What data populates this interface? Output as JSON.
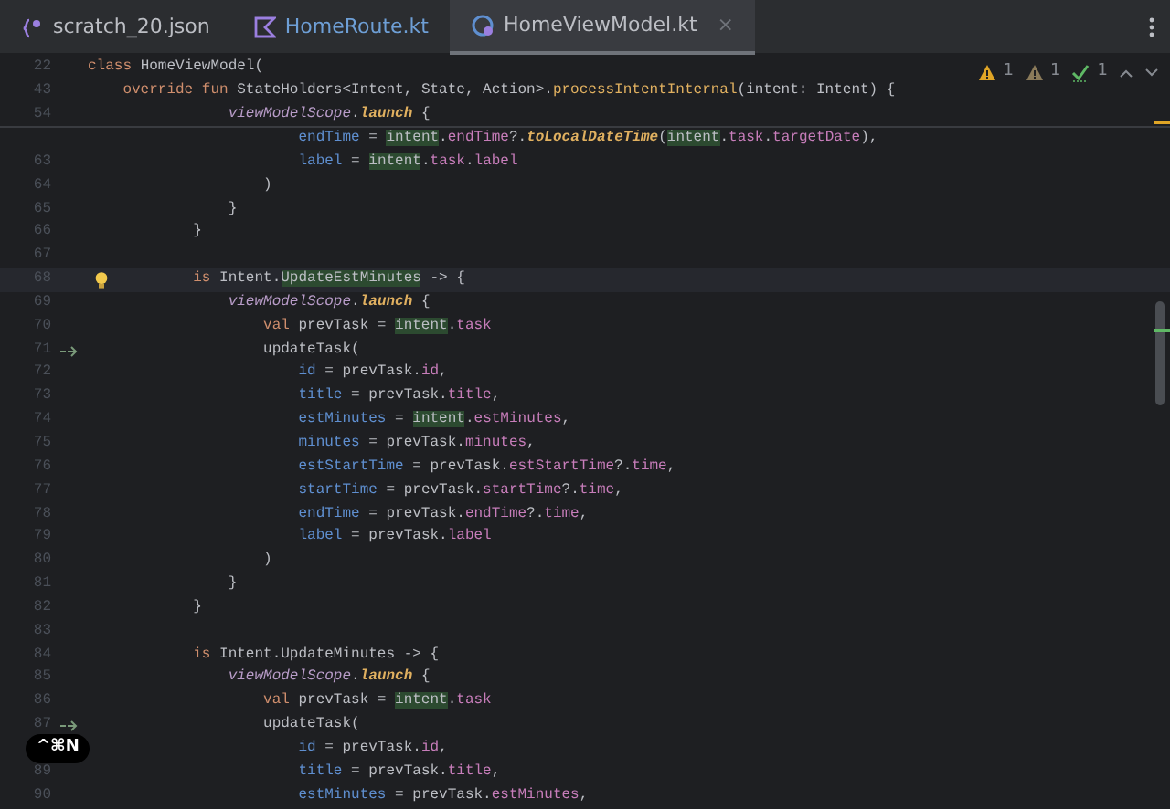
{
  "tabs": [
    {
      "label": "scratch_20.json",
      "kind": "json",
      "selected": false
    },
    {
      "label": "HomeRoute.kt",
      "kind": "kotlin",
      "selected": false
    },
    {
      "label": "HomeViewModel.kt",
      "kind": "class",
      "selected": true,
      "close": "×"
    }
  ],
  "inspections": [
    {
      "kind": "warning",
      "count": "1"
    },
    {
      "kind": "weak",
      "count": "1"
    },
    {
      "kind": "typo",
      "count": "1"
    }
  ],
  "sticky_lines": [
    {
      "number": "22",
      "tokens": [
        {
          "t": "class ",
          "kind": "keyword"
        },
        {
          "t": "HomeViewModel(",
          "kind": "plain"
        }
      ]
    },
    {
      "number": "43",
      "tokens": [
        {
          "t": "    override fun ",
          "kind": "keyword"
        },
        {
          "t": "StateHolders<Intent, State, Action>.",
          "kind": "plain"
        },
        {
          "t": "processIntentInternal",
          "kind": "function"
        },
        {
          "t": "(intent: Intent) {",
          "kind": "plain"
        }
      ]
    },
    {
      "number": "54",
      "tokens": [
        {
          "t": "                viewModelScope",
          "kind": "scope"
        },
        {
          "t": ".",
          "kind": "plain"
        },
        {
          "t": "launch",
          "kind": "call"
        },
        {
          "t": " {",
          "kind": "plain"
        }
      ]
    }
  ],
  "partial_line": {
    "tokens": [
      {
        "t": "                        endTime",
        "kind": "arg"
      },
      {
        "t": " = ",
        "kind": "plain"
      },
      {
        "t": "intent",
        "kind": "match"
      },
      {
        "t": ".",
        "kind": "plain"
      },
      {
        "t": "endTime",
        "kind": "member"
      },
      {
        "t": "?.",
        "kind": "plain"
      },
      {
        "t": "toLocalDateTime",
        "kind": "call"
      },
      {
        "t": "(",
        "kind": "plain"
      },
      {
        "t": "intent",
        "kind": "match"
      },
      {
        "t": ".",
        "kind": "plain"
      },
      {
        "t": "task",
        "kind": "member"
      },
      {
        "t": ".",
        "kind": "plain"
      },
      {
        "t": "targetDate",
        "kind": "member"
      },
      {
        "t": "),",
        "kind": "plain"
      }
    ]
  },
  "lines": [
    {
      "number": "63",
      "tokens": [
        {
          "t": "                        label",
          "kind": "arg"
        },
        {
          "t": " = ",
          "kind": "plain"
        },
        {
          "t": "intent",
          "kind": "match"
        },
        {
          "t": ".",
          "kind": "plain"
        },
        {
          "t": "task",
          "kind": "member"
        },
        {
          "t": ".",
          "kind": "plain"
        },
        {
          "t": "label",
          "kind": "member"
        }
      ]
    },
    {
      "number": "64",
      "tokens": [
        {
          "t": "                    )",
          "kind": "plain"
        }
      ]
    },
    {
      "number": "65",
      "tokens": [
        {
          "t": "                }",
          "kind": "plain"
        }
      ]
    },
    {
      "number": "66",
      "tokens": [
        {
          "t": "            }",
          "kind": "plain"
        }
      ]
    },
    {
      "number": "67"
    },
    {
      "number": "68",
      "current": true,
      "bulb": true,
      "tokens": [
        {
          "t": "            is ",
          "kind": "keyword"
        },
        {
          "t": "Intent.",
          "kind": "plain"
        },
        {
          "t": "UpdateEstMinutes",
          "kind": "match"
        },
        {
          "t": " -> {",
          "kind": "plain"
        }
      ]
    },
    {
      "number": "69",
      "tokens": [
        {
          "t": "                viewModelScope",
          "kind": "scope"
        },
        {
          "t": ".",
          "kind": "plain"
        },
        {
          "t": "launch",
          "kind": "call"
        },
        {
          "t": " {",
          "kind": "plain"
        }
      ]
    },
    {
      "number": "70",
      "tokens": [
        {
          "t": "                    val ",
          "kind": "keyword"
        },
        {
          "t": "prevTask = ",
          "kind": "plain"
        },
        {
          "t": "intent",
          "kind": "match"
        },
        {
          "t": ".",
          "kind": "plain"
        },
        {
          "t": "task",
          "kind": "member"
        }
      ]
    },
    {
      "number": "71",
      "arrow": true,
      "tokens": [
        {
          "t": "                    updateTask(",
          "kind": "plain"
        }
      ]
    },
    {
      "number": "72",
      "tokens": [
        {
          "t": "                        id",
          "kind": "arg"
        },
        {
          "t": " = prevTask.",
          "kind": "plain"
        },
        {
          "t": "id",
          "kind": "member"
        },
        {
          "t": ",",
          "kind": "plain"
        }
      ]
    },
    {
      "number": "73",
      "tokens": [
        {
          "t": "                        title",
          "kind": "arg"
        },
        {
          "t": " = prevTask.",
          "kind": "plain"
        },
        {
          "t": "title",
          "kind": "member"
        },
        {
          "t": ",",
          "kind": "plain"
        }
      ]
    },
    {
      "number": "74",
      "tokens": [
        {
          "t": "                        estMinutes",
          "kind": "arg"
        },
        {
          "t": " = ",
          "kind": "plain"
        },
        {
          "t": "intent",
          "kind": "match"
        },
        {
          "t": ".",
          "kind": "plain"
        },
        {
          "t": "estMinutes",
          "kind": "member"
        },
        {
          "t": ",",
          "kind": "plain"
        }
      ]
    },
    {
      "number": "75",
      "tokens": [
        {
          "t": "                        minutes",
          "kind": "arg"
        },
        {
          "t": " = prevTask.",
          "kind": "plain"
        },
        {
          "t": "minutes",
          "kind": "member"
        },
        {
          "t": ",",
          "kind": "plain"
        }
      ]
    },
    {
      "number": "76",
      "tokens": [
        {
          "t": "                        estStartTime",
          "kind": "arg"
        },
        {
          "t": " = prevTask.",
          "kind": "plain"
        },
        {
          "t": "estStartTime",
          "kind": "member"
        },
        {
          "t": "?.",
          "kind": "plain"
        },
        {
          "t": "time",
          "kind": "member"
        },
        {
          "t": ",",
          "kind": "plain"
        }
      ]
    },
    {
      "number": "77",
      "tokens": [
        {
          "t": "                        startTime",
          "kind": "arg"
        },
        {
          "t": " = prevTask.",
          "kind": "plain"
        },
        {
          "t": "startTime",
          "kind": "member"
        },
        {
          "t": "?.",
          "kind": "plain"
        },
        {
          "t": "time",
          "kind": "member"
        },
        {
          "t": ",",
          "kind": "plain"
        }
      ]
    },
    {
      "number": "78",
      "tokens": [
        {
          "t": "                        endTime",
          "kind": "arg"
        },
        {
          "t": " = prevTask.",
          "kind": "plain"
        },
        {
          "t": "endTime",
          "kind": "member"
        },
        {
          "t": "?.",
          "kind": "plain"
        },
        {
          "t": "time",
          "kind": "member"
        },
        {
          "t": ",",
          "kind": "plain"
        }
      ]
    },
    {
      "number": "79",
      "tokens": [
        {
          "t": "                        label",
          "kind": "arg"
        },
        {
          "t": " = prevTask.",
          "kind": "plain"
        },
        {
          "t": "label",
          "kind": "member"
        }
      ]
    },
    {
      "number": "80",
      "tokens": [
        {
          "t": "                    )",
          "kind": "plain"
        }
      ]
    },
    {
      "number": "81",
      "tokens": [
        {
          "t": "                }",
          "kind": "plain"
        }
      ]
    },
    {
      "number": "82",
      "tokens": [
        {
          "t": "            }",
          "kind": "plain"
        }
      ]
    },
    {
      "number": "83"
    },
    {
      "number": "84",
      "tokens": [
        {
          "t": "            is ",
          "kind": "keyword"
        },
        {
          "t": "Intent.UpdateMinutes -> {",
          "kind": "plain"
        }
      ]
    },
    {
      "number": "85",
      "tokens": [
        {
          "t": "                viewModelScope",
          "kind": "scope"
        },
        {
          "t": ".",
          "kind": "plain"
        },
        {
          "t": "launch",
          "kind": "call"
        },
        {
          "t": " {",
          "kind": "plain"
        }
      ]
    },
    {
      "number": "86",
      "tokens": [
        {
          "t": "                    val ",
          "kind": "keyword"
        },
        {
          "t": "prevTask = ",
          "kind": "plain"
        },
        {
          "t": "intent",
          "kind": "match"
        },
        {
          "t": ".",
          "kind": "plain"
        },
        {
          "t": "task",
          "kind": "member"
        }
      ]
    },
    {
      "number": "87",
      "arrow": true,
      "tokens": [
        {
          "t": "                    updateTask(",
          "kind": "plain"
        }
      ]
    },
    {
      "tokens": [
        {
          "t": "                        id",
          "kind": "arg"
        },
        {
          "t": " = prevTask.",
          "kind": "plain"
        },
        {
          "t": "id",
          "kind": "member"
        },
        {
          "t": ",",
          "kind": "plain"
        }
      ]
    },
    {
      "number": "89",
      "tokens": [
        {
          "t": "                        title",
          "kind": "arg"
        },
        {
          "t": " = prevTask.",
          "kind": "plain"
        },
        {
          "t": "title",
          "kind": "member"
        },
        {
          "t": ",",
          "kind": "plain"
        }
      ]
    },
    {
      "number": "90",
      "tokens": [
        {
          "t": "                        estMinutes",
          "kind": "arg"
        },
        {
          "t": " = prevTask.",
          "kind": "plain"
        },
        {
          "t": "estMinutes",
          "kind": "member"
        },
        {
          "t": ",",
          "kind": "plain"
        }
      ]
    }
  ],
  "shortcut_hint": "^⌘N"
}
